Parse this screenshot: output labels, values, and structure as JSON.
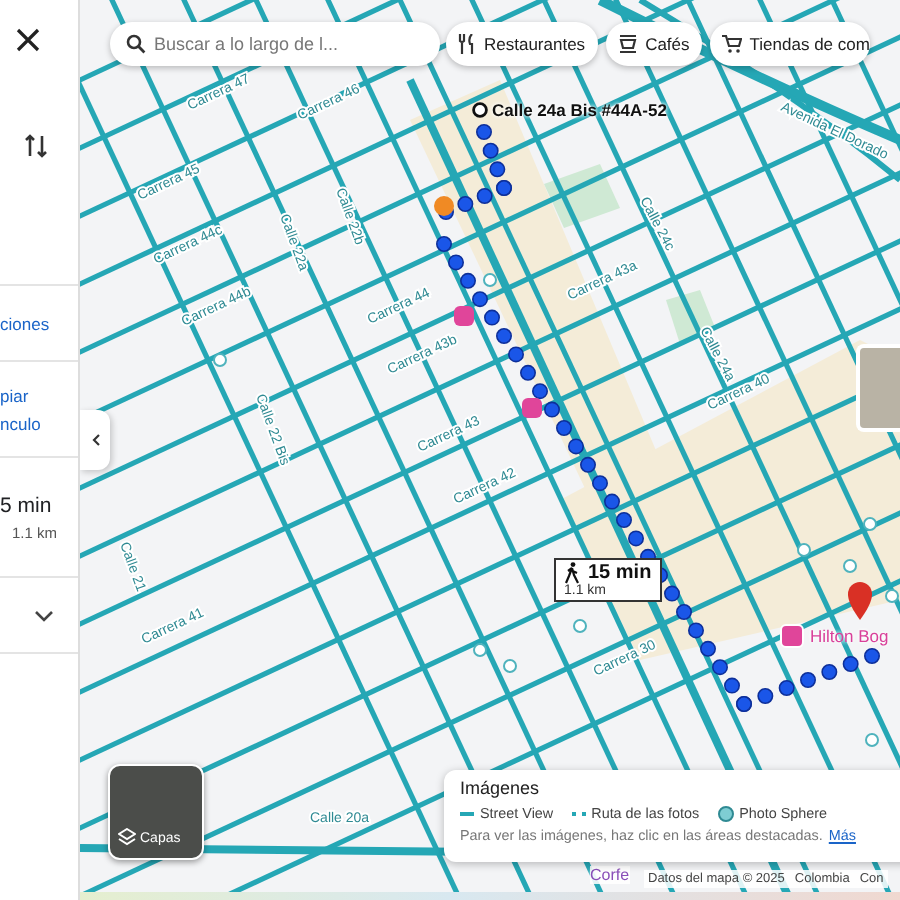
{
  "panel": {
    "directions": "ciones",
    "copy_link": "piar nculo",
    "duration": "5 min",
    "distance": "1.1 km"
  },
  "search": {
    "placeholder": "Buscar a lo largo de l..."
  },
  "chips": [
    {
      "kind": "restaurant",
      "label": "Restaurantes"
    },
    {
      "kind": "cafe",
      "label": "Cafés"
    },
    {
      "kind": "shop",
      "label": "Tiendas de com"
    }
  ],
  "map": {
    "streets": [
      "Carrera 47",
      "Carrera 46",
      "Carrera 45",
      "Carrera 44c",
      "Carrera 44b",
      "Carrera 44",
      "Carrera 43b",
      "Carrera 43",
      "Carrera 42",
      "Carrera 41",
      "Carrera 40",
      "Carrera 30",
      "Calle 22b",
      "Calle 22a",
      "Calle 22 Bis",
      "Calle 21",
      "Calle 20a",
      "Calle 24c",
      "Calle 24a",
      "Avenida El Dorado",
      "Carrera 43a"
    ],
    "destination": "Calle 24a Bis #44A-52",
    "route_label": {
      "duration": "15 min",
      "distance": "1.1 km"
    },
    "places": [
      {
        "kind": "hotel",
        "label": "Hilton Bog"
      },
      {
        "kind": "venue",
        "label": "Corfe"
      }
    ]
  },
  "layers": {
    "label": "Capas"
  },
  "imagery": {
    "title": "Imágenes",
    "legend": [
      {
        "kind": "line",
        "label": "Street View"
      },
      {
        "kind": "dashed",
        "label": "Ruta de las fotos"
      },
      {
        "kind": "dot",
        "label": "Photo Sphere"
      }
    ],
    "hint": "Para ver las imágenes, haz clic en las áreas destacadas.",
    "link": "Más"
  },
  "attribution": [
    "Datos del mapa © 2025",
    "Colombia",
    "Con"
  ]
}
